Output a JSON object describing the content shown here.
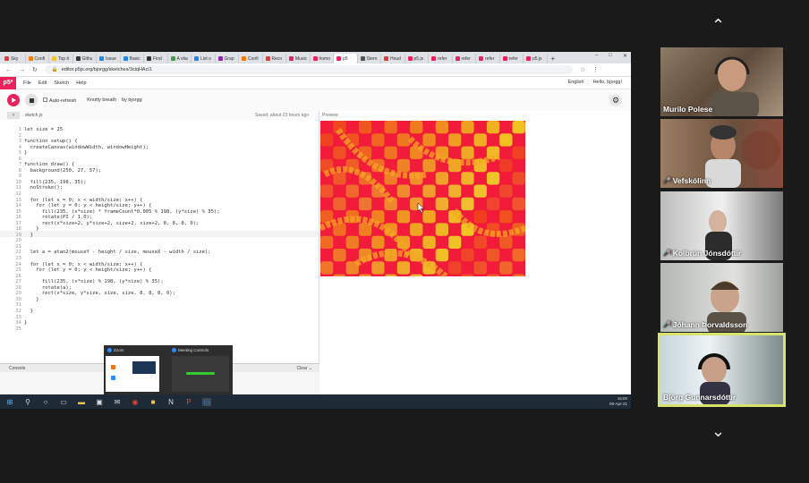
{
  "browser": {
    "tabs": [
      "Sky",
      "Confi",
      "Top it",
      "Githu",
      "Issue",
      "Basic",
      "Find",
      "A vita",
      "List o",
      "Grap",
      "Confi",
      "Recn",
      "Music",
      "homo",
      "p5",
      "Stern",
      "Houd",
      "p5.js",
      "refer",
      "refer",
      "refer",
      "refer",
      "p5.js"
    ],
    "url": "editor.p5js.org/bjorgg/sketches/3ciqHAcl1"
  },
  "p5": {
    "logo": "p5*",
    "menus": [
      "File",
      "Edit",
      "Sketch",
      "Help"
    ],
    "language": "English",
    "user": "Hello, bjorgg!",
    "autorefresh": "Auto-refresh",
    "sketch_name": "Knotty breath",
    "author": "by bjorgg",
    "file": "sketch.js",
    "saved": "Saved: about 23 hours ago",
    "preview": "Preview",
    "console": "Console",
    "clear": "Clear"
  },
  "code": {
    "line_numbers": "1\n2\n3\n4\n5\n6\n7\n8\n9\n10\n11\n12\n13\n14\n15\n16\n17\n18\n19\n20\n21\n22\n23\n24\n25\n26\n27\n28\n29\n30\n31\n32\n33\n34\n35",
    "text": "let size = 25\n\nfunction setup() {\n  createCanvas(windowWidth, windowHeight);\n}\n\nfunction draw() {\n  background(250, 27, 57);\n\n  fill(235, 198, 35);\n  noStroke();\n\n  for (let x = 0; x < width/size; x++) {\n    for (let y = 0; y < height/size; y++) {\n      fill(235, (x*size) * frameCount*0.005 % 198, (y*size) % 35);\n      rotate(PI / 1.0);\n      rect(x*size+2, y*size+2, size+2, size+2, 8, 8, 8, 0);\n    }\n  }\n\n\n  let a = atan2(mouseY - height / size, mouseX - width / size);\n\n  for (let x = 0; x < width/size; x++) {\n    for (let y = 0; y < height/size; y++) {\n\n      fill(235, (x*size) % 198, (y*size) % 35);\n      rotate(a);\n      rect(x*size, y*size, size, size, 8, 8, 8, 0);\n    }\n\n  }\n\n}"
  },
  "taskbar": {
    "time": "15:00",
    "date": "08-Apr-21"
  },
  "zoom_popup": {
    "item1": "Zoom",
    "item2": "Meeting Controls"
  },
  "participants": [
    {
      "name": "Murilo Polese",
      "muted": false
    },
    {
      "name": "Vefskólinn",
      "muted": true
    },
    {
      "name": "Kolbrún Jónsdóttir",
      "muted": true
    },
    {
      "name": "Jóhann Þorvaldsson",
      "muted": true
    },
    {
      "name": "Björg Gunnarsdóttir",
      "muted": false,
      "active": true
    }
  ],
  "colors": {
    "p5_pink": "#ed225d",
    "active_outline": "#d7e36b"
  }
}
